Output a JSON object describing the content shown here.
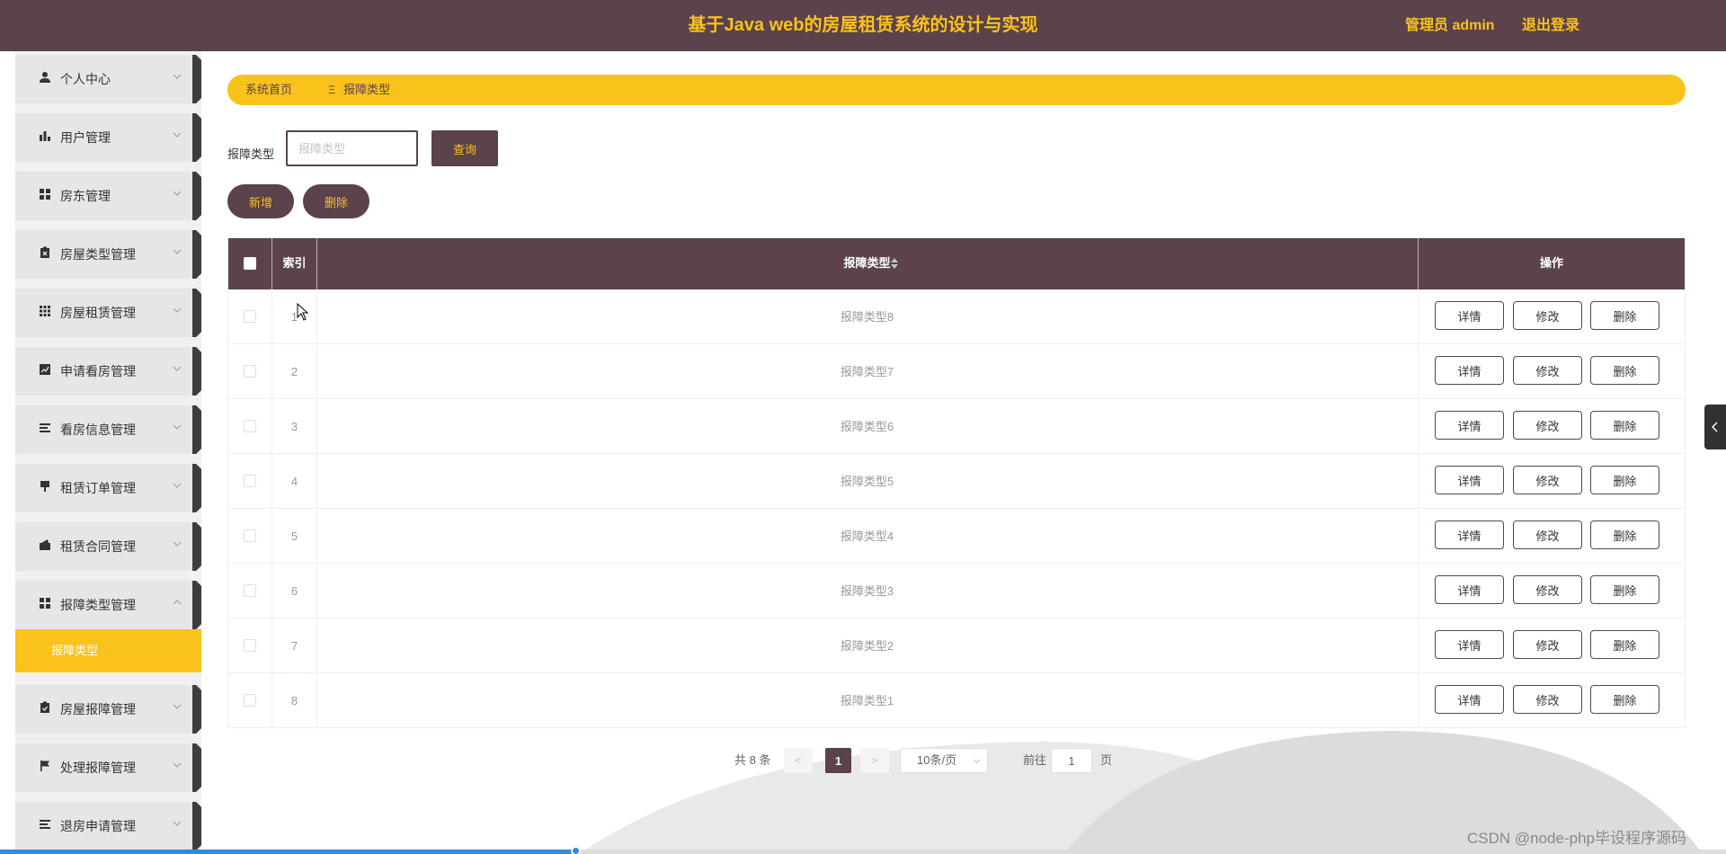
{
  "header": {
    "title": "基于Java web的房屋租赁系统的设计与实现",
    "admin_label": "管理员 admin",
    "logout_label": "退出登录"
  },
  "sidebar": {
    "items": [
      {
        "label": "个人中心",
        "icon": "person-icon",
        "expanded": false
      },
      {
        "label": "用户管理",
        "icon": "bar-chart-icon",
        "expanded": false
      },
      {
        "label": "房东管理",
        "icon": "grid-icon",
        "expanded": false
      },
      {
        "label": "房屋类型管理",
        "icon": "clipboard-x-icon",
        "expanded": false
      },
      {
        "label": "房屋租赁管理",
        "icon": "grid-dots-icon",
        "expanded": false
      },
      {
        "label": "申请看房管理",
        "icon": "line-chart-icon",
        "expanded": false
      },
      {
        "label": "看房信息管理",
        "icon": "list-icon",
        "expanded": false
      },
      {
        "label": "租赁订单管理",
        "icon": "sign-icon",
        "expanded": false
      },
      {
        "label": "租赁合同管理",
        "icon": "wallet-icon",
        "expanded": false
      },
      {
        "label": "报障类型管理",
        "icon": "grid-icon",
        "expanded": true
      },
      {
        "label": "房屋报障管理",
        "icon": "clipboard-check-icon",
        "expanded": false
      },
      {
        "label": "处理报障管理",
        "icon": "flag-icon",
        "expanded": false
      },
      {
        "label": "退房申请管理",
        "icon": "list-icon",
        "expanded": false
      }
    ],
    "active_sub_item": "报障类型"
  },
  "breadcrumb": {
    "home": "系统首页",
    "separator": "Ξ",
    "current": "报障类型"
  },
  "search": {
    "label": "报障类型",
    "placeholder": "报障类型",
    "value": "",
    "query_button": "查询"
  },
  "actions": {
    "add": "新增",
    "delete": "删除"
  },
  "table": {
    "columns": {
      "index": "索引",
      "type": "报障类型",
      "ops": "操作"
    },
    "rows": [
      {
        "index": "1",
        "type": "报障类型8"
      },
      {
        "index": "2",
        "type": "报障类型7"
      },
      {
        "index": "3",
        "type": "报障类型6"
      },
      {
        "index": "4",
        "type": "报障类型5"
      },
      {
        "index": "5",
        "type": "报障类型4"
      },
      {
        "index": "6",
        "type": "报障类型3"
      },
      {
        "index": "7",
        "type": "报障类型2"
      },
      {
        "index": "8",
        "type": "报障类型1"
      }
    ],
    "row_buttons": {
      "detail": "详情",
      "edit": "修改",
      "delete": "删除"
    }
  },
  "pagination": {
    "total": "共 8 条",
    "prev": "<",
    "current_page": "1",
    "next": ">",
    "page_size": "10条/页",
    "goto_label": "前往",
    "goto_value": "1",
    "page_unit": "页"
  },
  "watermark": "CSDN @node-php毕设程序源码",
  "colors": {
    "primary": "#5b424b",
    "accent": "#f9c21c"
  }
}
